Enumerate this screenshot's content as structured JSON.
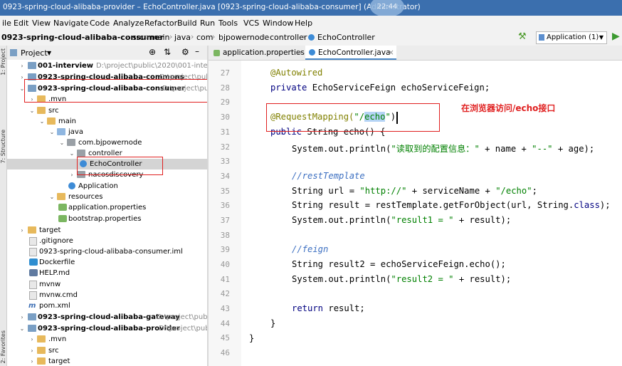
{
  "window": {
    "title": "0923-spring-cloud-alibaba-provider – EchoController.java [0923-spring-cloud-alibaba-consumer] (Administrator)",
    "clock": "22:44"
  },
  "menu": [
    "ile",
    "Edit",
    "View",
    "Navigate",
    "Code",
    "Analyze",
    "Refactor",
    "Build",
    "Run",
    "Tools",
    "VCS",
    "Window",
    "Help"
  ],
  "breadcrumb": [
    "0923-spring-cloud-alibaba-consumer",
    "src",
    "main",
    "java",
    "com",
    "bjpowernode",
    "controller",
    "EchoController"
  ],
  "run_config": "Application (1)",
  "left_strip": [
    "1: Project",
    "7: Structure",
    "2: Favorites"
  ],
  "project_panel": {
    "title": "Project"
  },
  "tree": [
    {
      "label": "001-interview",
      "path": "D:\\project\\public\\2020\\001-interview"
    },
    {
      "label": "0923-spring-cloud-alibaba-commons",
      "path": "D:\\project\\pub"
    },
    {
      "label": "0923-spring-cloud-alibaba-consumer",
      "path": "D:\\project\\public"
    },
    {
      "label": ".mvn",
      "path": ""
    },
    {
      "label": "src",
      "path": ""
    },
    {
      "label": "main",
      "path": ""
    },
    {
      "label": "java",
      "path": ""
    },
    {
      "label": "com.bjpowernode",
      "path": ""
    },
    {
      "label": "controller",
      "path": ""
    },
    {
      "label": "EchoController",
      "path": ""
    },
    {
      "label": "nacosdiscovery",
      "path": ""
    },
    {
      "label": "Application",
      "path": ""
    },
    {
      "label": "resources",
      "path": ""
    },
    {
      "label": "application.properties",
      "path": ""
    },
    {
      "label": "bootstrap.properties",
      "path": ""
    },
    {
      "label": "target",
      "path": ""
    },
    {
      "label": ".gitignore",
      "path": ""
    },
    {
      "label": "0923-spring-cloud-alibaba-consumer.iml",
      "path": ""
    },
    {
      "label": "Dockerfile",
      "path": ""
    },
    {
      "label": "HELP.md",
      "path": ""
    },
    {
      "label": "mvnw",
      "path": ""
    },
    {
      "label": "mvnw.cmd",
      "path": ""
    },
    {
      "label": "pom.xml",
      "path": ""
    },
    {
      "label": "0923-spring-cloud-alibaba-gateway",
      "path": "D:\\project\\public\\"
    },
    {
      "label": "0923-spring-cloud-alibaba-provider",
      "path": "D:\\project\\public\\"
    },
    {
      "label": ".mvn",
      "path": ""
    },
    {
      "label": "src",
      "path": ""
    },
    {
      "label": "target",
      "path": ""
    }
  ],
  "tabs": [
    {
      "label": "application.properties"
    },
    {
      "label": "EchoController.java"
    }
  ],
  "line_numbers": [
    "27",
    "28",
    "29",
    "30",
    "31",
    "32",
    "33",
    "34",
    "35",
    "36",
    "37",
    "38",
    "39",
    "40",
    "41",
    "42",
    "43",
    "44",
    "45",
    "46"
  ],
  "code": {
    "l27": "@Autowired",
    "l28_kw": "private ",
    "l28_rest": "EchoServiceFeign echoServiceFeign;",
    "l30_ann": "@RequestMapping(",
    "l30_str_a": "\"/",
    "l30_sel": "echo",
    "l30_str_b": "\"",
    "l30_end": ")",
    "l31_kw": "public ",
    "l31_rest": "String echo() {",
    "l32_a": "System.out.println(",
    "l32_str1": "\"读取到的配置信息：\"",
    "l32_b": " + name + ",
    "l32_str2": "\"--\"",
    "l32_c": " + age);",
    "l34": "//restTemplate",
    "l35_a": "String url = ",
    "l35_str1": "\"http://\"",
    "l35_b": " + serviceName + ",
    "l35_str2": "\"/echo\"",
    "l35_c": ";",
    "l36_a": "String result = restTemplate.getForObject(url, String.",
    "l36_kw": "class",
    "l36_b": ");",
    "l37_a": "System.out.println(",
    "l37_str": "\"result1 = \"",
    "l37_b": " + result);",
    "l39": "//feign",
    "l40": "String result2 = echoServiceFeign.echo();",
    "l41_a": "System.out.println(",
    "l41_str": "\"result2 = \"",
    "l41_b": " + result);",
    "l43_kw": "return ",
    "l43_rest": "result;",
    "l44": "}",
    "l46": "}"
  },
  "annotation_note": "在浏览器访问/echo接口",
  "colors": {
    "annotation_red": "#e02020",
    "selection": "#b5d4f5",
    "keyword": "#000080",
    "string": "#008000",
    "comment": "#3c6fc1"
  }
}
